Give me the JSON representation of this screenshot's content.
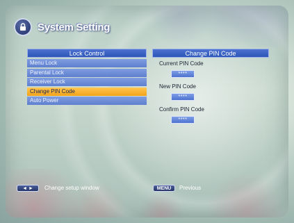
{
  "title": "System Setting",
  "lock_panel": {
    "header": "Lock Control",
    "items": [
      {
        "label": "Menu Lock"
      },
      {
        "label": "Parental Lock"
      },
      {
        "label": "Receiver Lock"
      },
      {
        "label": "Change PIN Code",
        "active": true
      },
      {
        "label": "Auto Power"
      }
    ]
  },
  "pin_panel": {
    "header": "Change PIN Code",
    "current_label": "Current PIN Code",
    "current_value": "****",
    "new_label": "New PIN Code",
    "new_value": "****",
    "confirm_label": "Confirm PIN Code",
    "confirm_value": "****"
  },
  "footer": {
    "key1": "◄ ►",
    "hint1": "Change setup window",
    "key2": "MENU",
    "hint2": "Previous"
  },
  "colors": {
    "header_blue": "#2d56b8",
    "menu_blue": "#6f8fd8",
    "highlight_orange": "#f2a21a",
    "background_teal": "#b8cec6"
  }
}
